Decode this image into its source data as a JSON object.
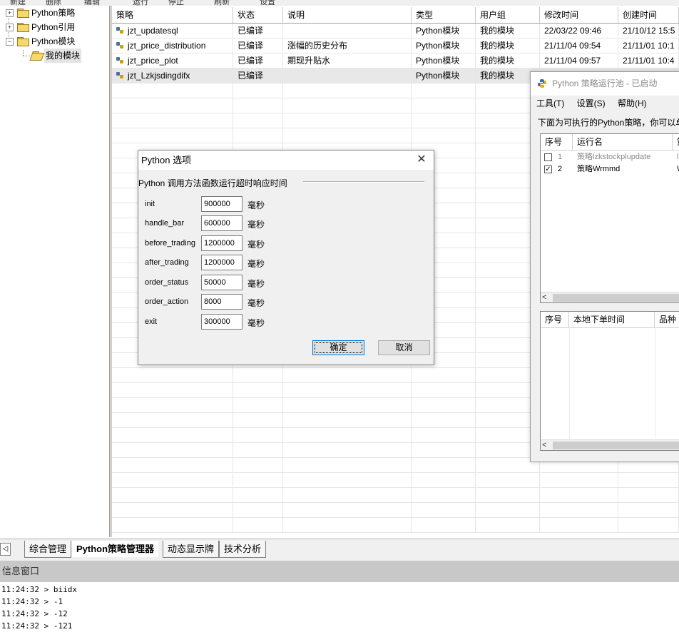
{
  "toolbar": {
    "items": [
      "新建",
      "删除",
      "编辑",
      "运行",
      "停止",
      "刷新",
      "设置"
    ]
  },
  "tree": {
    "items": [
      {
        "label": "Python策略"
      },
      {
        "label": "Python引用"
      },
      {
        "label": "Python模块"
      },
      {
        "label": "我的模块"
      }
    ]
  },
  "grid": {
    "columns": [
      "策略",
      "状态",
      "说明",
      "类型",
      "用户组",
      "修改时间",
      "创建时间"
    ],
    "rows": [
      [
        "jzt_updatesql",
        "已编译",
        "",
        "Python模块",
        "我的模块",
        "22/03/22 09:46",
        "21/10/12 15:5"
      ],
      [
        "jzt_price_distribution",
        "已编译",
        "涨幅的历史分布",
        "Python模块",
        "我的模块",
        "21/11/04 09:54",
        "21/11/01 10:1"
      ],
      [
        "jzt_price_plot",
        "已编译",
        "期现升贴水",
        "Python模块",
        "我的模块",
        "21/11/04 09:57",
        "21/11/01 10:4"
      ],
      [
        "jzt_Lzkjsdingdifx",
        "已编译",
        "",
        "Python模块",
        "我的模块",
        "",
        ""
      ]
    ]
  },
  "tabs": {
    "scroll_left": "◁",
    "items": [
      "综合管理",
      "Python策略管理器",
      "动态显示牌",
      "技术分析"
    ],
    "active_index": 1
  },
  "info": {
    "title": "信息窗口",
    "lines": [
      "11:24:32 > biidx",
      "11:24:32 > -1",
      "11:24:32 > -12",
      "11:24:32 > -121"
    ]
  },
  "dialog": {
    "title": "Python 选项",
    "group_label": "Python 调用方法函数运行超时响应时间",
    "options": [
      {
        "label": "init",
        "value": "900000",
        "unit": "毫秒"
      },
      {
        "label": "handle_bar",
        "value": "600000",
        "unit": "毫秒"
      },
      {
        "label": "before_trading",
        "value": "1200000",
        "unit": "毫秒"
      },
      {
        "label": "after_trading",
        "value": "1200000",
        "unit": "毫秒"
      },
      {
        "label": "order_status",
        "value": "50000",
        "unit": "毫秒"
      },
      {
        "label": "order_action",
        "value": "8000",
        "unit": "毫秒"
      },
      {
        "label": "exit",
        "value": "300000",
        "unit": "毫秒"
      }
    ],
    "ok_label": "确定",
    "cancel_label": "取消",
    "close_glyph": "✕"
  },
  "pool": {
    "title": "Python 策略运行池 - 已启动",
    "menu": [
      "工具(T)",
      "设置(S)",
      "帮助(H)"
    ],
    "description": "下面为可执行的Python策略，你可以单",
    "list_columns": [
      "序号",
      "运行名",
      "策"
    ],
    "list_rows": [
      {
        "index": "1",
        "name": "策略lzkstockplupdate",
        "extra": "lz",
        "checked": false,
        "dim": true
      },
      {
        "index": "2",
        "name": "策略Wrmmd",
        "extra": "W",
        "checked": true,
        "dim": false
      }
    ],
    "order_columns": [
      "序号",
      "本地下单时间",
      "品种"
    ],
    "scroll_glyph": "<"
  },
  "colors": {
    "accent": "#0078d7",
    "tree_folder": "#f5d96b",
    "selected_row": "#e8e8e8",
    "info_header_bg": "#c8c8c8"
  }
}
